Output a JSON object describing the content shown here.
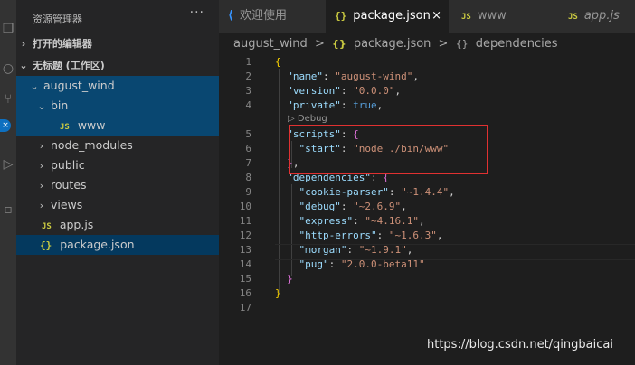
{
  "sidebar": {
    "title": "资源管理器",
    "more": "···",
    "open_editors": "打开的编辑器",
    "workspace": "无标题 (工作区)",
    "tree": [
      {
        "label": "august_wind",
        "chevron": "⌄",
        "indent": 1
      },
      {
        "label": "bin",
        "chevron": "⌄",
        "indent": 2
      },
      {
        "label": "www",
        "badge": "JS",
        "indent": 3
      },
      {
        "label": "node_modules",
        "chevron": "›",
        "indent": 2
      },
      {
        "label": "public",
        "chevron": "›",
        "indent": 2
      },
      {
        "label": "routes",
        "chevron": "›",
        "indent": 2
      },
      {
        "label": "views",
        "chevron": "›",
        "indent": 2
      },
      {
        "label": "app.js",
        "badge": "JS",
        "indent": 2
      },
      {
        "label": "package.json",
        "badge": "{}",
        "indent": 2
      }
    ]
  },
  "tabs": [
    {
      "label": "欢迎使用",
      "icon": "vscode-icon"
    },
    {
      "label": "package.json",
      "icon": "json-icon",
      "active": true,
      "close": "×"
    },
    {
      "label": "www",
      "icon": "js-icon"
    },
    {
      "label": "app.js",
      "icon": "js-icon"
    }
  ],
  "tab_icons": {
    "json": "{}",
    "js": "JS",
    "vscode": "⟨"
  },
  "breadcrumb": {
    "folder": "august_wind",
    "file_icon": "{}",
    "file": "package.json",
    "node_icon": "{}",
    "node": "dependencies",
    "sep": ">"
  },
  "editor": {
    "line_numbers": [
      "1",
      "2",
      "3",
      "4",
      "5",
      "6",
      "7",
      "8",
      "9",
      "10",
      "11",
      "12",
      "13",
      "14",
      "15",
      "16",
      "17"
    ],
    "codelens": "▷ Debug",
    "pkg": {
      "name_key": "\"name\"",
      "name_val": "\"august-wind\"",
      "version_key": "\"version\"",
      "version_val": "\"0.0.0\"",
      "private_key": "\"private\"",
      "private_val": "true",
      "scripts_key": "\"scripts\"",
      "start_key": "\"start\"",
      "start_val": "\"node ./bin/www\"",
      "deps_key": "\"dependencies\""
    },
    "deps": [
      {
        "key": "\"cookie-parser\"",
        "val": "\"~1.4.4\""
      },
      {
        "key": "\"debug\"",
        "val": "\"~2.6.9\""
      },
      {
        "key": "\"express\"",
        "val": "\"~4.16.1\""
      },
      {
        "key": "\"http-errors\"",
        "val": "\"~1.6.3\""
      },
      {
        "key": "\"morgan\"",
        "val": "\"~1.9.1\""
      },
      {
        "key": "\"pug\"",
        "val": "\"2.0.0-beta11\""
      }
    ]
  },
  "watermark": "https://blog.csdn.net/qingbaicai",
  "colors": {
    "accent": "#0e70c0",
    "highlight_box": "#e03131",
    "active_row": "#094771"
  }
}
